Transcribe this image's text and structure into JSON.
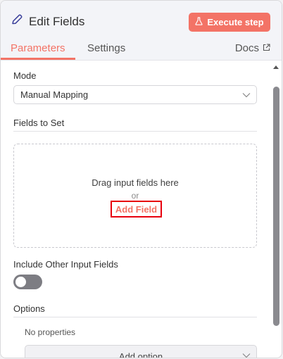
{
  "header": {
    "title": "Edit Fields",
    "execute_label": "Execute step",
    "tabs": [
      {
        "label": "Parameters",
        "active": true
      },
      {
        "label": "Settings",
        "active": false
      }
    ],
    "docs_label": "Docs"
  },
  "form": {
    "mode_label": "Mode",
    "mode_value": "Manual Mapping",
    "fields_to_set_label": "Fields to Set",
    "drop_text": "Drag input fields here",
    "or_text": "or",
    "add_field_label": "Add Field",
    "include_other_label": "Include Other Input Fields",
    "include_other_enabled": false,
    "options_label": "Options",
    "no_properties_text": "No properties",
    "add_option_label": "Add option"
  },
  "colors": {
    "accent": "#f37366",
    "highlight_box": "#e8000d"
  },
  "icons": {
    "title": "pencil-icon",
    "execute": "flask-icon",
    "docs": "external-link-icon",
    "dropdown": "chevron-down-icon"
  }
}
